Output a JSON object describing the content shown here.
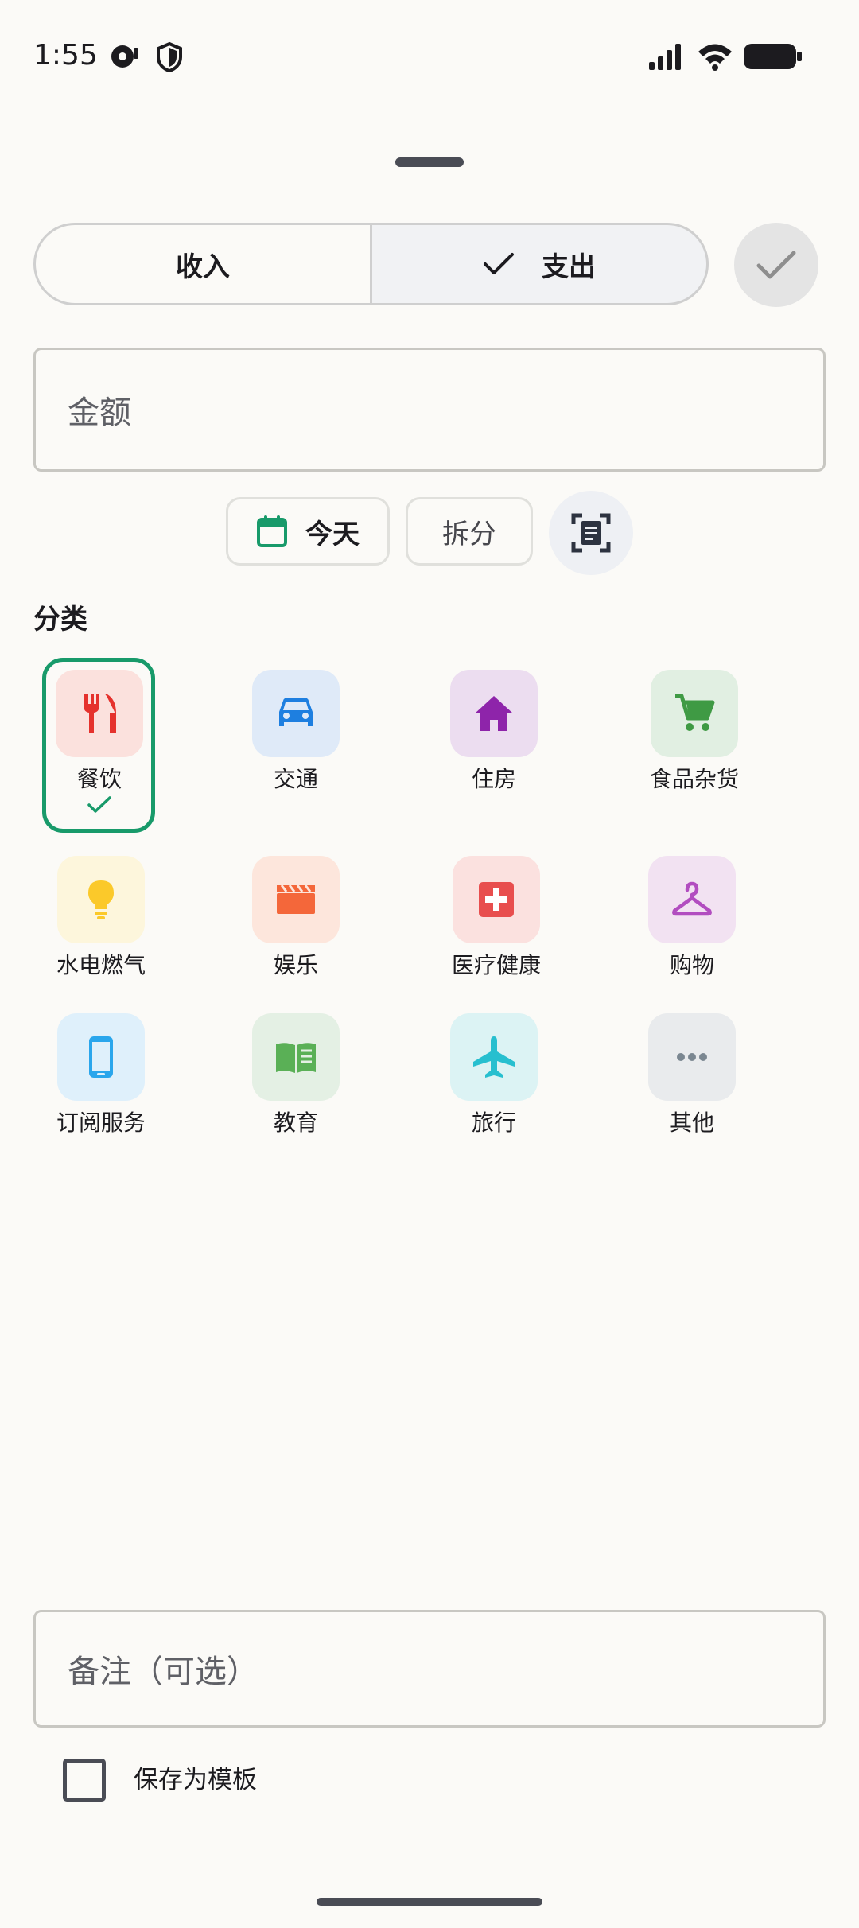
{
  "status_bar": {
    "time": "1:55",
    "icons": [
      "notification-icon",
      "shield-icon",
      "signal-icon",
      "wifi-icon",
      "battery-icon"
    ]
  },
  "type_toggle": {
    "income_label": "收入",
    "expense_label": "支出",
    "selected": "expense",
    "confirm_icon": "check-icon"
  },
  "amount": {
    "placeholder": "金额",
    "value": ""
  },
  "chips": {
    "date_label": "今天",
    "date_icon": "calendar-icon",
    "split_label": "拆分",
    "scan_icon": "receipt-scan-icon"
  },
  "category": {
    "title": "分类",
    "selected": "餐饮",
    "items": [
      {
        "label": "餐饮",
        "icon": "restaurant-icon",
        "tile_color": "#fbe1dd",
        "icon_color": "#e5322d"
      },
      {
        "label": "交通",
        "icon": "car-icon",
        "tile_color": "#dfeaf8",
        "icon_color": "#1e7fe0"
      },
      {
        "label": "住房",
        "icon": "home-icon",
        "tile_color": "#ecddf0",
        "icon_color": "#8e24aa"
      },
      {
        "label": "食品杂货",
        "icon": "cart-icon",
        "tile_color": "#e1efe2",
        "icon_color": "#3f9a44"
      },
      {
        "label": "水电燃气",
        "icon": "lightbulb-icon",
        "tile_color": "#fdf6dc",
        "icon_color": "#fbc92a"
      },
      {
        "label": "娱乐",
        "icon": "movie-icon",
        "tile_color": "#fde6dc",
        "icon_color": "#f4673a"
      },
      {
        "label": "医疗健康",
        "icon": "medical-icon",
        "tile_color": "#fbe1df",
        "icon_color": "#e84e4e"
      },
      {
        "label": "购物",
        "icon": "hanger-icon",
        "tile_color": "#f2e2f2",
        "icon_color": "#b24dc0"
      },
      {
        "label": "订阅服务",
        "icon": "phone-icon",
        "tile_color": "#dff0fb",
        "icon_color": "#2aa6ec"
      },
      {
        "label": "教育",
        "icon": "book-icon",
        "tile_color": "#e4f0e4",
        "icon_color": "#5ab056"
      },
      {
        "label": "旅行",
        "icon": "airplane-icon",
        "tile_color": "#dcf3f4",
        "icon_color": "#27bfcf"
      },
      {
        "label": "其他",
        "icon": "more-icon",
        "tile_color": "#e9ebed",
        "icon_color": "#7b8791"
      }
    ]
  },
  "note": {
    "placeholder": "备注（可选）",
    "value": ""
  },
  "template": {
    "label": "保存为模板",
    "checked": false
  },
  "colors": {
    "accent": "#189a6a",
    "background": "#fbfaf7"
  }
}
